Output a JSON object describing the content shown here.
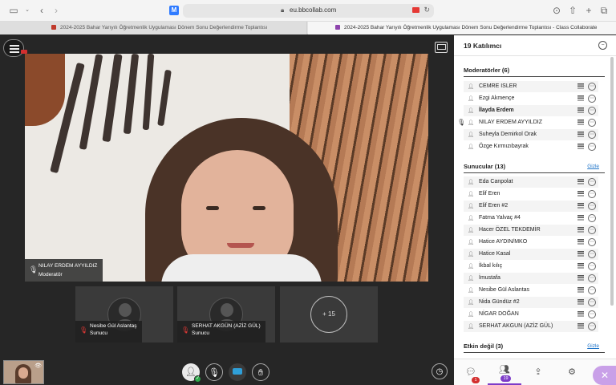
{
  "browser": {
    "url": "eu.bbcollab.com",
    "tabs": [
      {
        "title": "2024-2025 Bahar Yarıyılı Öğretmenlik Uygulaması Dönem Sonu Değerlendirme Toplantısı"
      },
      {
        "title": "2024-2025 Bahar Yarıyılı Öğretmenlik Uygulaması Dönem Sonu Değerlendirme Toplantısı - Class Collaborate"
      }
    ]
  },
  "stage": {
    "presenter": {
      "name": "NILAY ERDEM AYYILDIZ",
      "role": "Moderatör"
    },
    "tiles": [
      {
        "name": "Nesibe Gül Aslantaş",
        "role": "Sunucu"
      },
      {
        "name": "SERHAT AKGÜN (AZİZ GÜL)",
        "role": "Sunucu"
      }
    ],
    "more_label": "+ 15"
  },
  "panel": {
    "title": "19 Katılımcı",
    "hide_label": "Gizle",
    "moderators": {
      "title": "Moderatörler (6)",
      "items": [
        "CEMRE ISLER",
        "Ezgi Akmençe",
        "İlayda Erdem",
        "NILAY ERDEM AYYILDIZ",
        "Suheyla Demirkol Orak",
        "Özge Kırmızıbayrak"
      ]
    },
    "presenters": {
      "title": "Sunucular (13)",
      "items": [
        "Eda Canpolat",
        "Elif Eren",
        "Elif Eren #2",
        "Fatma Yalvaç #4",
        "Hacer ÖZEL TEKDEMİR",
        "Hatice AYDIN/MKO",
        "Hatice Kasal",
        "İkbal kılıç",
        "İmustafa",
        "Nesibe Gül Aslantas",
        "Nida Gündüz #2",
        "NİGAR DOĞAN",
        "SERHAT AKGUN (AZİZ GÜL)"
      ]
    },
    "away": {
      "title": "Etkin değil (3)"
    },
    "footer": {
      "chat_badge": "1",
      "participants_badge": "19"
    }
  }
}
